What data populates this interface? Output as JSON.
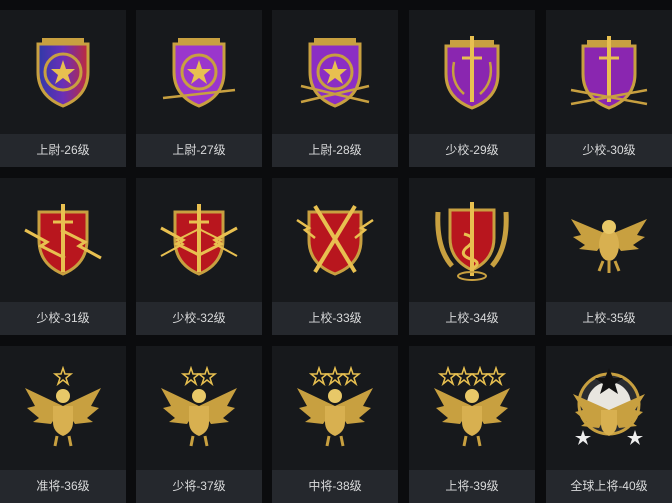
{
  "badges": [
    {
      "label": "上尉-26级",
      "icon": "shield-star-purple-blue-icon",
      "shield": "#3a3ab0",
      "shield2": "#8b2fc0",
      "accent": "#c8a040"
    },
    {
      "label": "上尉-27级",
      "icon": "shield-star-purple-arrow-icon",
      "shield": "#8a2cc8",
      "shield2": "#b04ad8",
      "accent": "#c8a040"
    },
    {
      "label": "上尉-28级",
      "icon": "shield-star-purple-arrows-icon",
      "shield": "#7e2ab8",
      "shield2": "#a844d0",
      "accent": "#c8a040"
    },
    {
      "label": "少校-29级",
      "icon": "shield-sword-purple-icon",
      "shield": "#7a1e98",
      "shield2": "#a43ac0",
      "accent": "#c8a040"
    },
    {
      "label": "少校-30级",
      "icon": "shield-sword-purple-arrows-icon",
      "shield": "#7a1e98",
      "shield2": "#a43ac0",
      "accent": "#c8a040"
    },
    {
      "label": "少校-31级",
      "icon": "shield-sword-red-lightning-icon",
      "shield": "#a8121a",
      "shield2": "#d22a2a",
      "accent": "#c8a040"
    },
    {
      "label": "少校-32级",
      "icon": "shield-sword-red-lightning-double-icon",
      "shield": "#a8121a",
      "shield2": "#d22a2a",
      "accent": "#c8a040"
    },
    {
      "label": "上校-33级",
      "icon": "shield-crossed-swords-red-icon",
      "shield": "#a8121a",
      "shield2": "#d22a2a",
      "accent": "#c8a040"
    },
    {
      "label": "上校-34级",
      "icon": "shield-sword-snake-wings-icon",
      "shield": "#a8121a",
      "shield2": "#d22a2a",
      "accent": "#c8a040"
    },
    {
      "label": "上校-35级",
      "icon": "golden-eagle-icon",
      "shield": "",
      "shield2": "",
      "accent": "#c8a040"
    },
    {
      "label": "准将-36级",
      "icon": "eagle-one-star-icon",
      "shield": "",
      "shield2": "",
      "accent": "#c8a040"
    },
    {
      "label": "少将-37级",
      "icon": "eagle-two-stars-icon",
      "shield": "",
      "shield2": "",
      "accent": "#c8a040"
    },
    {
      "label": "中将-38级",
      "icon": "eagle-three-stars-icon",
      "shield": "",
      "shield2": "",
      "accent": "#c8a040"
    },
    {
      "label": "上将-39级",
      "icon": "eagle-four-stars-icon",
      "shield": "",
      "shield2": "",
      "accent": "#c8a040"
    },
    {
      "label": "全球上将-40级",
      "icon": "eagle-globe-stars-icon",
      "shield": "",
      "shield2": "",
      "accent": "#c8a040"
    }
  ]
}
